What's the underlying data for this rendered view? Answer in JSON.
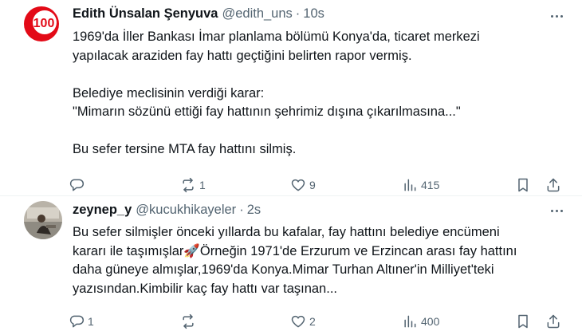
{
  "posts": [
    {
      "display_name": "Edith Ünsalan Şenyuva",
      "handle": "@edith_uns",
      "separator": "·",
      "time": "10s",
      "avatar_text": "100",
      "lines": [
        "1969'da İller Bankası İmar planlama bölümü Konya'da, ticaret merkezi",
        "yapılacak araziden fay hattı geçtiğini belirten rapor vermiş.",
        "",
        "Belediye meclisinin verdiği karar:",
        "\"Mimarın sözünü ettiği fay hattının şehrimiz dışına çıkarılmasına...\"",
        "",
        "Bu sefer tersine MTA fay hattını silmiş."
      ],
      "replies": "",
      "reposts": "1",
      "likes": "9",
      "views": "415"
    },
    {
      "display_name": "zeynep_y",
      "handle": "@kucukhikayeler",
      "separator": "·",
      "time": "2s",
      "lines": [
        "Bu sefer silmişler önceki yıllarda bu kafalar, fay hattını belediye encümeni",
        "kararı ile taşımışlar🚀Örneğin 1971'de Erzurum ve Erzincan arası fay hattını",
        "daha güneye almışlar,1969'da Konya.Mimar Turhan Altıner'in Milliyet'teki",
        "yazısından.Kimbilir kaç fay hattı var taşınan..."
      ],
      "replies": "1",
      "reposts": "",
      "likes": "2",
      "views": "400"
    }
  ],
  "icons": {
    "reply": "reply-icon",
    "repost": "repost-icon",
    "like": "heart-icon",
    "views": "views-icon",
    "bookmark": "bookmark-icon",
    "share": "share-icon",
    "more": "more-icon"
  },
  "colors": {
    "text": "#0f1419",
    "secondary": "#536471",
    "divider": "#eff3f4",
    "avatar_red": "#e30a17"
  }
}
